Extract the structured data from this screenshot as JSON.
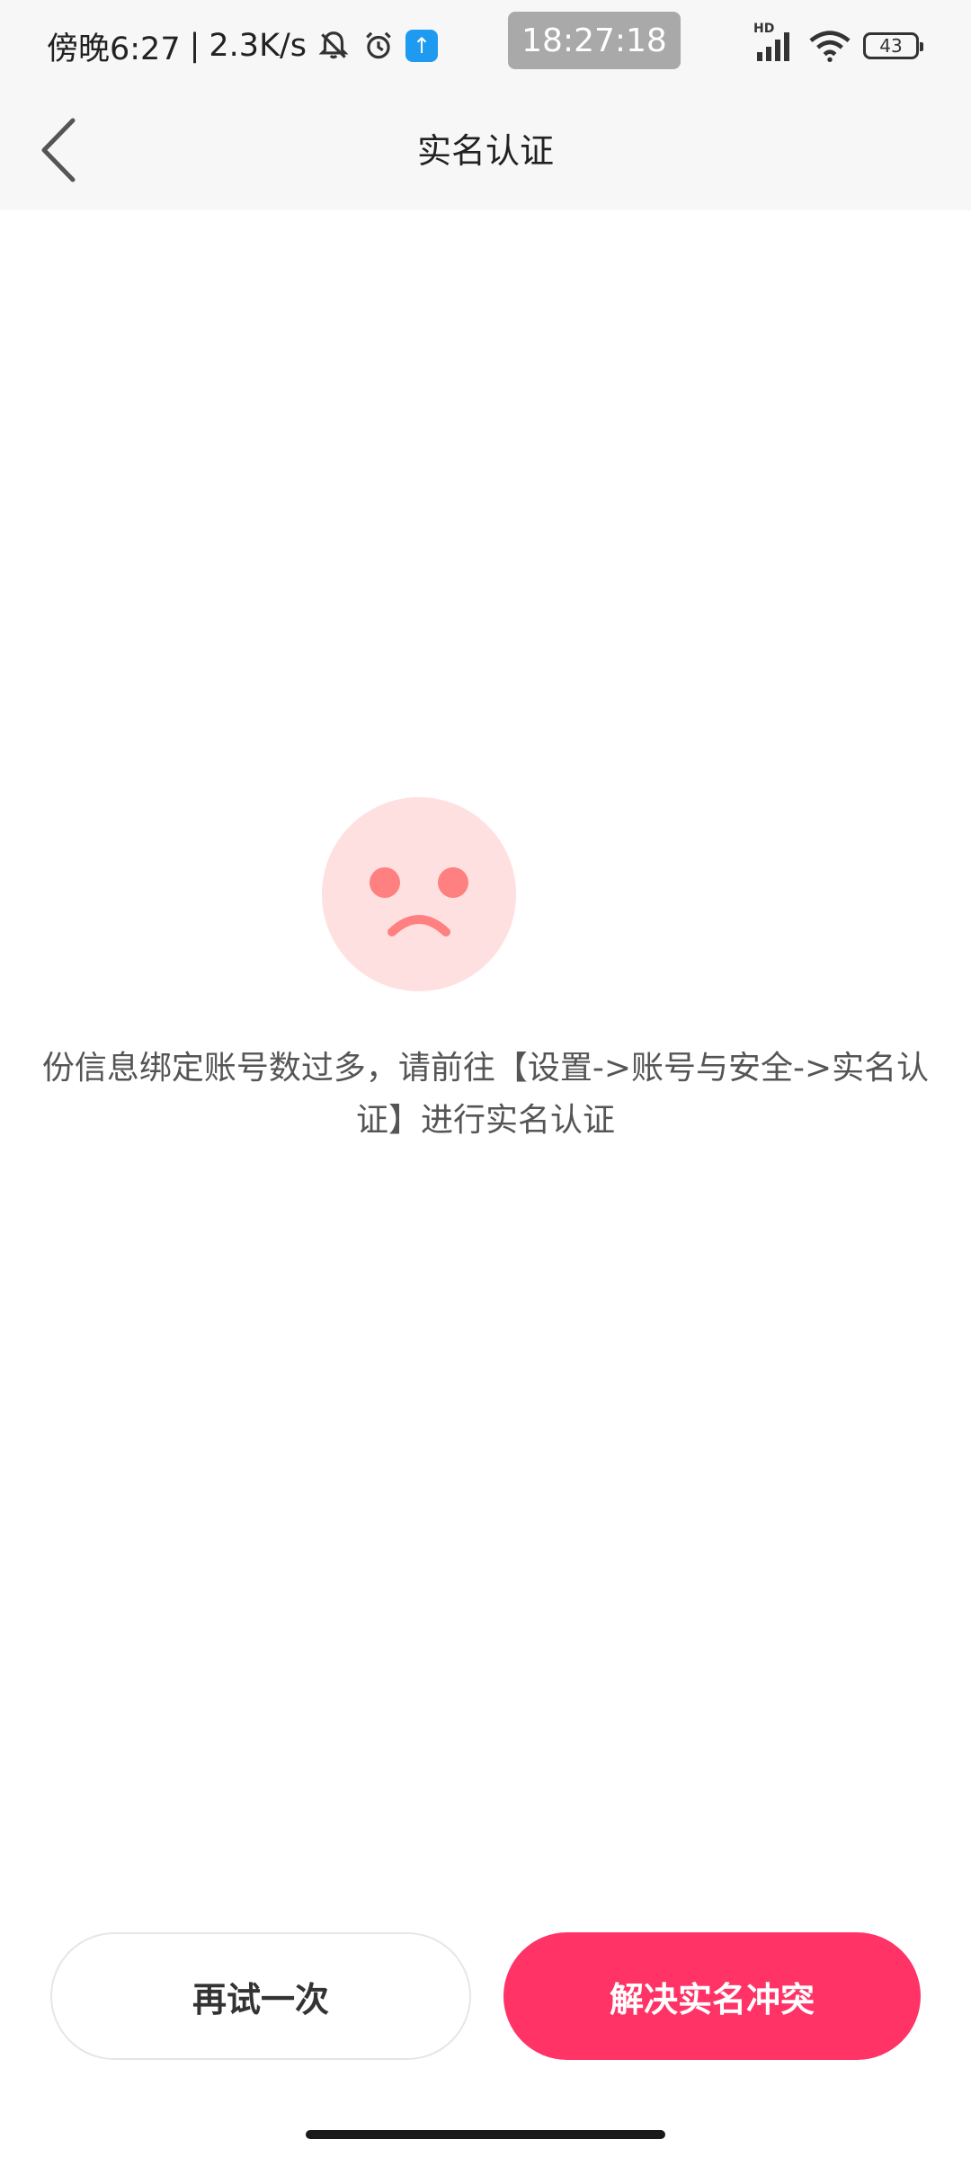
{
  "status_bar": {
    "time_text": "傍晚6:27",
    "separator": "|",
    "network_speed": "2.3K/s",
    "time_pill": "18:27:18",
    "signal_label": "HD",
    "battery_level": "43",
    "icons": [
      "muted-bell-icon",
      "alarm-icon",
      "app-upload-icon",
      "hd-signal-icon",
      "wifi-icon",
      "battery-icon"
    ]
  },
  "nav": {
    "title": "实名认证",
    "back_icon": "chevron-left-icon"
  },
  "error": {
    "icon": "sad-face-icon",
    "message": "份信息绑定账号数过多，请前往【设置->账号与安全->实名认证】进行实名认证"
  },
  "actions": {
    "retry_label": "再试一次",
    "resolve_label": "解决实名冲突"
  },
  "colors": {
    "accent": "#ff3366",
    "face_bg": "#ffe0e0",
    "face_features": "#ff8080",
    "bar_bg": "#f7f7f7"
  }
}
